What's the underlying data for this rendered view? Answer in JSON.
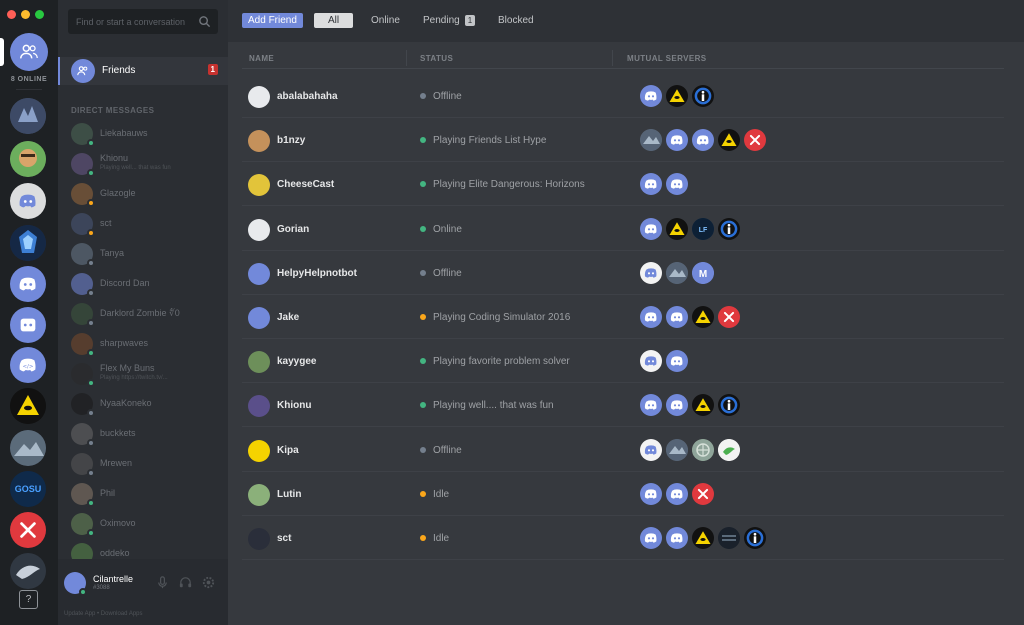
{
  "rail": {
    "online_count": "8 ONLINE",
    "help": "?"
  },
  "dm_column": {
    "search_placeholder": "Find or start a conversation",
    "friends_label": "Friends",
    "friends_badge": "1",
    "dm_header": "DIRECT MESSAGES",
    "items": [
      {
        "name": "Liekabauws",
        "sub": "",
        "status": "online"
      },
      {
        "name": "Khionu",
        "sub": "Playing well... that was fun",
        "status": "online"
      },
      {
        "name": "Glazogle",
        "sub": "",
        "status": "idle"
      },
      {
        "name": "sct",
        "sub": "",
        "status": "idle"
      },
      {
        "name": "Tanya",
        "sub": "",
        "status": "offline"
      },
      {
        "name": "Discord Dan",
        "sub": "",
        "status": "offline"
      },
      {
        "name": "Darklord Zombie ∜0",
        "sub": "",
        "status": "offline"
      },
      {
        "name": "sharpwaves",
        "sub": "",
        "status": "online"
      },
      {
        "name": "Flex My Buns",
        "sub": "Playing https://twitch.tv/...",
        "status": "online"
      },
      {
        "name": "NyaaKoneko",
        "sub": "",
        "status": "offline"
      },
      {
        "name": "buckkets",
        "sub": "",
        "status": "offline"
      },
      {
        "name": "Mrewen",
        "sub": "",
        "status": "offline"
      },
      {
        "name": "Phil",
        "sub": "",
        "status": "online"
      },
      {
        "name": "Oximovo",
        "sub": "",
        "status": "online"
      },
      {
        "name": "oddeko",
        "sub": "",
        "status": "online"
      }
    ],
    "user": {
      "name": "Cilantrelle",
      "tag": "#3088",
      "footer": "Update App  •  Download Apps"
    }
  },
  "topbar": {
    "add_friend": "Add Friend",
    "all": "All",
    "online": "Online",
    "pending": "Pending",
    "pending_count": "1",
    "blocked": "Blocked"
  },
  "table": {
    "headers": {
      "name": "NAME",
      "status": "STATUS",
      "servers": "MUTUAL SERVERS"
    },
    "rows": [
      {
        "name": "abalabahaha",
        "status": "Offline",
        "state": "offline",
        "servers": [
          "discord-blue",
          "triangle",
          "info"
        ]
      },
      {
        "name": "b1nzy",
        "status": "Playing Friends List Hype",
        "state": "online",
        "servers": [
          "art",
          "discord-blue",
          "discord-blue",
          "triangle",
          "hammer"
        ]
      },
      {
        "name": "CheeseCast",
        "status": "Playing Elite Dangerous: Horizons",
        "state": "online",
        "servers": [
          "discord-blue",
          "discord-blue"
        ]
      },
      {
        "name": "Gorian",
        "status": "Online",
        "state": "online",
        "servers": [
          "discord-blue",
          "triangle",
          "lf",
          "info"
        ]
      },
      {
        "name": "HelpyHelpnotbot",
        "status": "Offline",
        "state": "offline",
        "servers": [
          "discord-white",
          "art",
          "m"
        ]
      },
      {
        "name": "Jake",
        "status": "Playing Coding Simulator 2016",
        "state": "idle",
        "servers": [
          "discord-blue",
          "discord-blue",
          "triangle",
          "hammer"
        ]
      },
      {
        "name": "kayygee",
        "status": "Playing favorite problem solver",
        "state": "online",
        "servers": [
          "discord-white",
          "discord-blue"
        ]
      },
      {
        "name": "Khionu",
        "status": "Playing well.... that was fun",
        "state": "online",
        "servers": [
          "discord-blue",
          "discord-blue",
          "triangle",
          "info"
        ]
      },
      {
        "name": "Kipa",
        "status": "Offline",
        "state": "offline",
        "servers": [
          "discord-white",
          "art",
          "globe",
          "bird"
        ]
      },
      {
        "name": "Lutin",
        "status": "Idle",
        "state": "idle",
        "servers": [
          "discord-blue",
          "discord-blue",
          "hammer"
        ]
      },
      {
        "name": "sct",
        "status": "Idle",
        "state": "idle",
        "servers": [
          "discord-blue",
          "discord-blue",
          "triangle",
          "dark",
          "info"
        ]
      }
    ]
  },
  "colors": {
    "online": "#43b581",
    "idle": "#faa61a",
    "offline": "#747f8d",
    "blurple": "#7289da"
  }
}
